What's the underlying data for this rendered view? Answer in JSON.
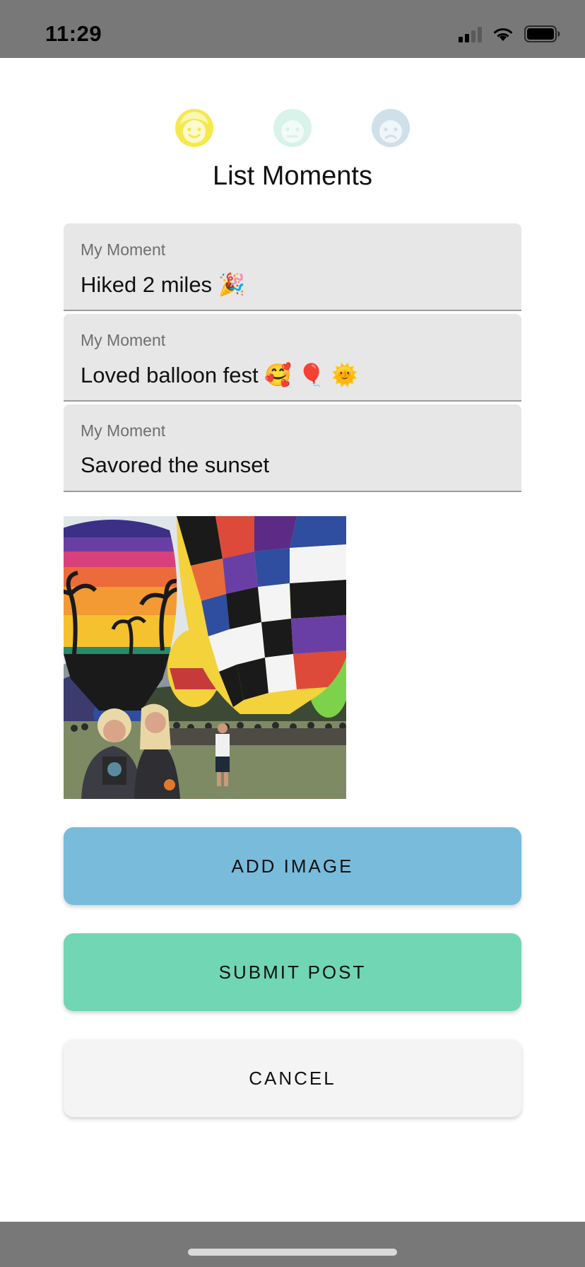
{
  "status_bar": {
    "time": "11:29",
    "icons": [
      "cellular-signal-icon",
      "wifi-icon",
      "battery-icon"
    ]
  },
  "moods": [
    {
      "name": "happy-face-icon",
      "color": "#f5e94e",
      "selected": true
    },
    {
      "name": "neutral-face-icon",
      "color": "#d9f2ea",
      "selected": false
    },
    {
      "name": "sad-face-icon",
      "color": "#cfe0ea",
      "selected": false
    }
  ],
  "page": {
    "title": "List Moments"
  },
  "moments": [
    {
      "label": "My Moment",
      "value": "Hiked 2 miles 🎉"
    },
    {
      "label": "My Moment",
      "value": "Loved balloon fest 🥰 🎈 🌞"
    },
    {
      "label": "My Moment",
      "value": "Savored the sunset"
    }
  ],
  "photo": {
    "description": "hot-air-balloon-photo"
  },
  "buttons": {
    "add_image": "ADD IMAGE",
    "submit_post": "SUBMIT POST",
    "cancel": "CANCEL"
  },
  "colors": {
    "add_image_bg": "#78bbdb",
    "submit_bg": "#70d6b3",
    "cancel_bg": "#f4f4f4",
    "field_bg": "#e7e7e7",
    "status_bar_bg": "#787878"
  }
}
